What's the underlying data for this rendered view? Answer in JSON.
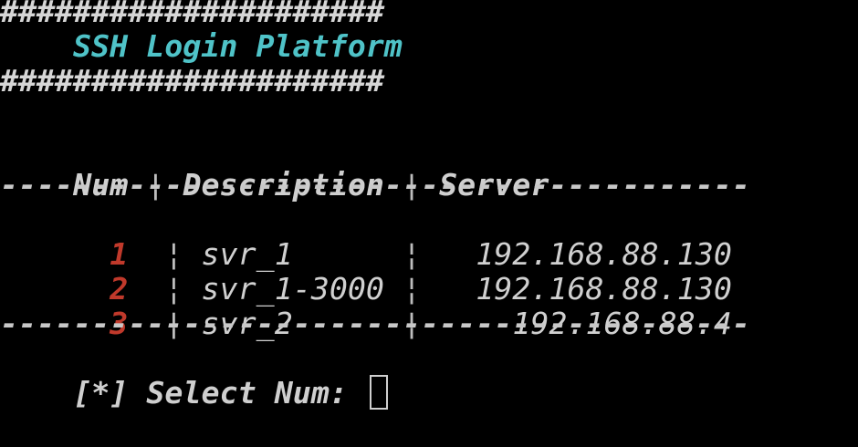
{
  "banner": {
    "top_border": "#####################",
    "title": "SSH Login Platform",
    "bottom_border": "#####################"
  },
  "table": {
    "headers": {
      "num": "Num",
      "description": "Description",
      "server": "Server"
    },
    "separator": "¦",
    "rule": "-----------------------------------------",
    "rows": [
      {
        "num": "1",
        "description": "svr_1",
        "server": "192.168.88.130"
      },
      {
        "num": "2",
        "description": "svr_1-3000",
        "server": "192.168.88.130"
      },
      {
        "num": "3",
        "description": "svr_2",
        "server": "192.168.88.4"
      }
    ]
  },
  "prompt": {
    "marker": "[*]",
    "label": "Select Num:",
    "value": ""
  },
  "colors": {
    "background": "#000000",
    "title": "#4fc3c8",
    "num": "#c0392b",
    "text": "#d6d6d6"
  }
}
